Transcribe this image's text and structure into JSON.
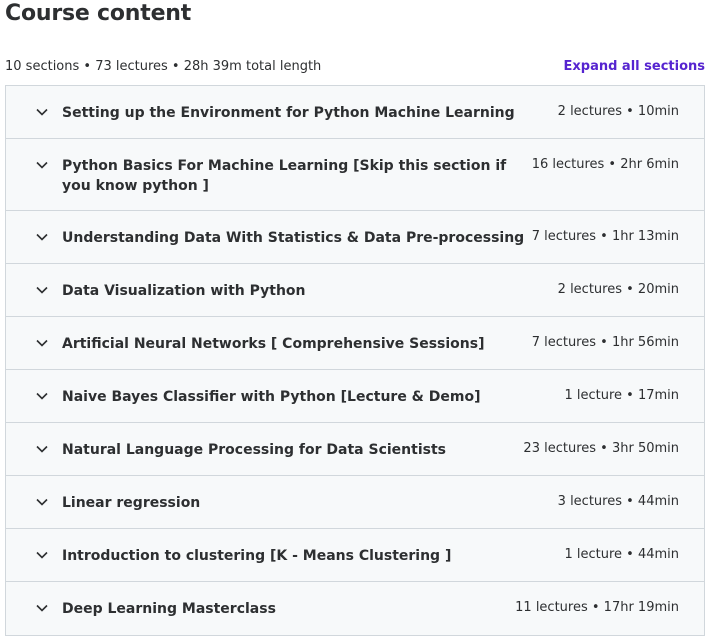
{
  "header": {
    "title": "Course content",
    "summary": "10 sections • 73 lectures • 28h 39m total length",
    "expand_label": "Expand all sections"
  },
  "sections": [
    {
      "title": "Setting up the Environment for Python Machine Learning",
      "meta": "2 lectures • 10min"
    },
    {
      "title": "Python Basics For Machine Learning [Skip this section if you know python ]",
      "meta": "16 lectures • 2hr 6min"
    },
    {
      "title": "Understanding Data With Statistics & Data Pre-processing",
      "meta": "7 lectures • 1hr 13min"
    },
    {
      "title": "Data Visualization with Python",
      "meta": "2 lectures • 20min"
    },
    {
      "title": "Artificial Neural Networks [ Comprehensive Sessions]",
      "meta": "7 lectures • 1hr 56min"
    },
    {
      "title": "Naive Bayes Classifier with Python [Lecture & Demo]",
      "meta": "1 lecture • 17min"
    },
    {
      "title": "Natural Language Processing for Data Scientists",
      "meta": "23 lectures • 3hr 50min"
    },
    {
      "title": "Linear regression",
      "meta": "3 lectures • 44min"
    },
    {
      "title": "Introduction to clustering [K - Means Clustering ]",
      "meta": "1 lecture • 44min"
    },
    {
      "title": "Deep Learning Masterclass",
      "meta": "11 lectures • 17hr 19min"
    }
  ],
  "icons": {
    "section_toggle": "chevron-down-icon"
  },
  "colors": {
    "accent": "#5624d0",
    "text": "#2d2f31",
    "section_bg": "#f7f9fa",
    "border": "#d1d7dc"
  }
}
